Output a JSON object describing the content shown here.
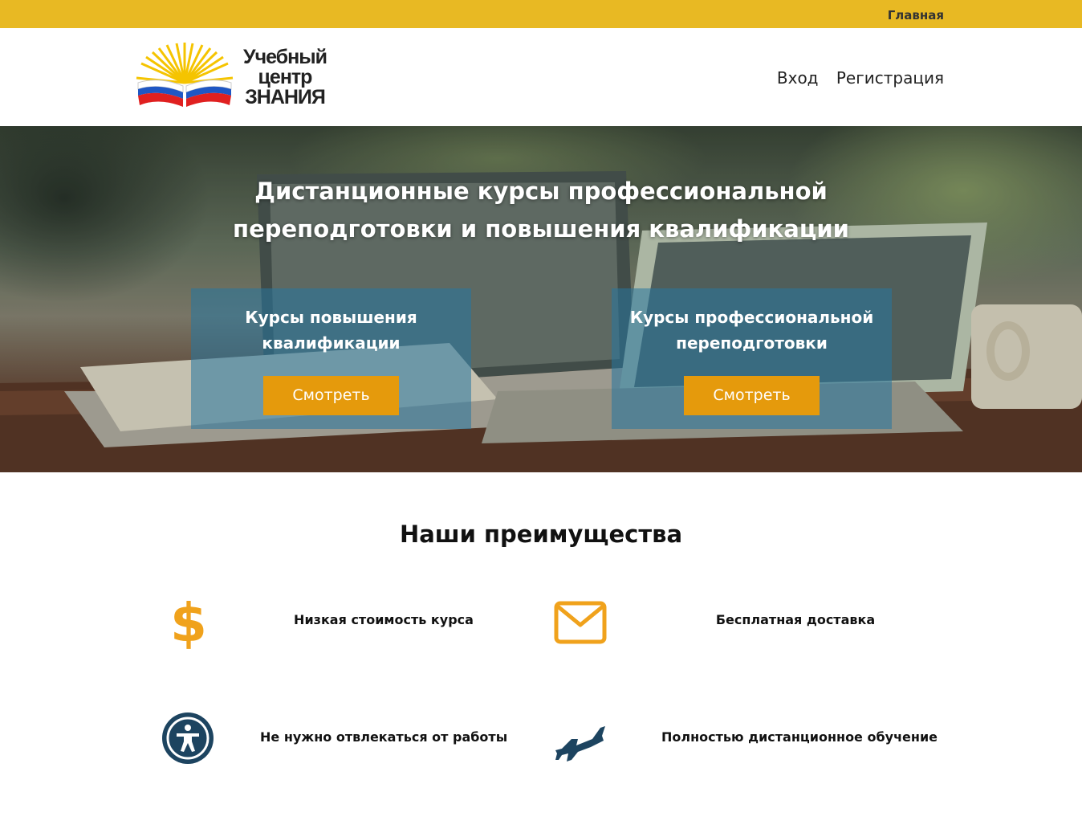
{
  "topbar": {
    "home_link": "Главная"
  },
  "header": {
    "logo_text": "Учебный центр ЗНАНИЯ",
    "nav": {
      "login": "Вход",
      "register": "Регистрация"
    }
  },
  "hero": {
    "title": "Дистанционные курсы профессиональной переподготовки и повышения квалификации",
    "cards": [
      {
        "title": "Курсы повышения квалификации",
        "button": "Смотреть"
      },
      {
        "title": "Курсы профессиональной переподготовки",
        "button": "Смотреть"
      }
    ]
  },
  "advantages": {
    "title": "Наши преимущества",
    "items": [
      {
        "label": "Низкая стоимость курса",
        "icon": "dollar-icon"
      },
      {
        "label": "Бесплатная доставка",
        "icon": "envelope-icon"
      },
      {
        "label": "Не нужно отвлекаться от работы",
        "icon": "accessibility-icon"
      },
      {
        "label": "Полностью дистанционное обучение",
        "icon": "fighter-jet-icon"
      }
    ]
  },
  "colors": {
    "topbar": "#e8b923",
    "button": "#e59a0c",
    "icon_orange": "#f0a21c",
    "icon_navy": "#1d4460",
    "card_overlay": "#2676a0"
  }
}
